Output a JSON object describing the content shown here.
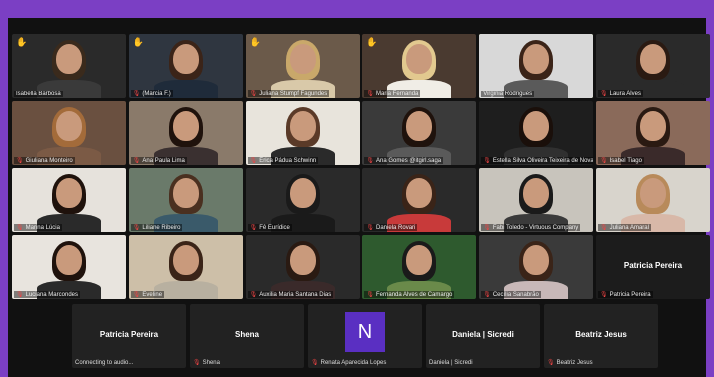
{
  "participants": [
    {
      "name": "Isabella Barbosa",
      "hand": true,
      "active": false,
      "mic": false,
      "bg": "#2a2a2a",
      "hair": "#3a2a1c",
      "shirt": "#3a3a3a"
    },
    {
      "name": "(Marcia F.)",
      "hand": true,
      "active": false,
      "mic": true,
      "bg": "#2f3640",
      "hair": "#3b2418",
      "shirt": "#1f2b3a"
    },
    {
      "name": "Juliana Stumpf Fagundes",
      "hand": true,
      "active": false,
      "mic": true,
      "bg": "#6b5a4a",
      "hair": "#c9a86a",
      "shirt": "#d9c9a9"
    },
    {
      "name": "Maria Fernanda",
      "hand": true,
      "active": false,
      "mic": true,
      "bg": "#4a3a30",
      "hair": "#e2c98f",
      "shirt": "#f0ede6"
    },
    {
      "name": "Virginia Rodrigues",
      "hand": false,
      "active": true,
      "mic": false,
      "bg": "#d8d8d8",
      "hair": "#3b2418",
      "shirt": "#5a5a5a"
    },
    {
      "name": "Laura Alves",
      "hand": false,
      "active": false,
      "mic": true,
      "bg": "#2a2a2a",
      "hair": "#2a1a12",
      "shirt": "#2a2a2a"
    },
    {
      "name": "Giuliana Monteiro",
      "hand": false,
      "active": false,
      "mic": true,
      "bg": "#6a5040",
      "hair": "#a36b3a",
      "shirt": "#7b5a45"
    },
    {
      "name": "Ana Paula Lima",
      "hand": false,
      "active": false,
      "mic": true,
      "bg": "#8a7a6a",
      "hair": "#1f120c",
      "shirt": "#3a3030"
    },
    {
      "name": "Érica Pádua Schwinn",
      "hand": false,
      "active": false,
      "mic": true,
      "bg": "#e8e4dc",
      "hair": "#5a3a28",
      "shirt": "#2a2a2a"
    },
    {
      "name": "Ana Gomes @itgirl.saga",
      "hand": false,
      "active": false,
      "mic": true,
      "bg": "#3a3a3a",
      "hair": "#1f120c",
      "shirt": "#5a5a5a"
    },
    {
      "name": "Estella Silva Oliveira Teixeira de Novaes",
      "hand": false,
      "active": false,
      "mic": true,
      "bg": "#1e1e1e",
      "hair": "#1a0f0a",
      "shirt": "#303030"
    },
    {
      "name": "Isabel Tiago",
      "hand": false,
      "active": false,
      "mic": true,
      "bg": "#8a6a5a",
      "hair": "#2a1a12",
      "shirt": "#3a2a2a"
    },
    {
      "name": "Marina Lúcia",
      "hand": false,
      "active": false,
      "mic": true,
      "bg": "#e6e2dc",
      "hair": "#1f120c",
      "shirt": "#2a2a2a"
    },
    {
      "name": "Liliane Ribeiro",
      "hand": false,
      "active": false,
      "mic": true,
      "bg": "#6a7a6a",
      "hair": "#4a3020",
      "shirt": "#3a5a6a"
    },
    {
      "name": "Fê Eurídice",
      "hand": false,
      "active": false,
      "mic": true,
      "bg": "#2a2a2a",
      "hair": "#1a1a1a",
      "shirt": "#1a1a1a"
    },
    {
      "name": "Daniela Rovari",
      "hand": false,
      "active": false,
      "mic": true,
      "bg": "#2a2a2a",
      "hair": "#3a2418",
      "shirt": "#c83a3a"
    },
    {
      "name": "Fabi Toledo - Virtuous Company",
      "hand": false,
      "active": false,
      "mic": true,
      "bg": "#c8c4bc",
      "hair": "#1a1a1a",
      "shirt": "#3a3a3a"
    },
    {
      "name": "Juliana Amaral",
      "hand": false,
      "active": false,
      "mic": true,
      "bg": "#d8d4cc",
      "hair": "#b88a5a",
      "shirt": "#d8b8a8"
    },
    {
      "name": "Luciana Marcondes",
      "hand": false,
      "active": false,
      "mic": true,
      "bg": "#e8e4de",
      "hair": "#1f120c",
      "shirt": "#2a2a2a"
    },
    {
      "name": "Eveline",
      "hand": false,
      "active": false,
      "mic": true,
      "bg": "#cdbfa8",
      "hair": "#3a2418",
      "shirt": "#b8b0a0"
    },
    {
      "name": "Auxilia Maria Santana Dias",
      "hand": false,
      "active": false,
      "mic": true,
      "bg": "#2a2a2a",
      "hair": "#2a1a12",
      "shirt": "#3a2a2a"
    },
    {
      "name": "Fernanda Alves de Camargo",
      "hand": false,
      "active": false,
      "mic": true,
      "bg": "#2e5a2e",
      "hair": "#1a1a1a",
      "shirt": "#6a8a4a"
    },
    {
      "name": "Cecília Sanabrão",
      "hand": false,
      "active": false,
      "mic": true,
      "bg": "#3a3a3a",
      "hair": "#3a2418",
      "shirt": "#c8b8b8"
    },
    {
      "name": "Patricia Pereira",
      "hand": false,
      "active": false,
      "mic": true,
      "dark": true,
      "center": "Patricia Pereira"
    }
  ],
  "bottom_row": [
    {
      "label": "Patricia Pereira",
      "name": "Connecting to audio...",
      "mic": false
    },
    {
      "label": "Shena",
      "name": "Shena",
      "mic": true
    },
    {
      "avatar": "N",
      "name": "Renata Aparecida Lopes",
      "mic": true
    },
    {
      "label": "Daniela | Sicredi",
      "name": "Daniela | Sicredi",
      "mic": false
    },
    {
      "label": "Beatriz Jesus",
      "name": "Beatriz Jesus",
      "mic": true
    }
  ],
  "colors": {
    "border": "#7b3fc4",
    "active_outline": "#b6e36a",
    "mic_muted": "#e44444",
    "avatar_bg": "#5a2fc2"
  },
  "icons": {
    "raised_hand": "raised-hand-icon",
    "muted_mic": "mic-muted-icon"
  }
}
